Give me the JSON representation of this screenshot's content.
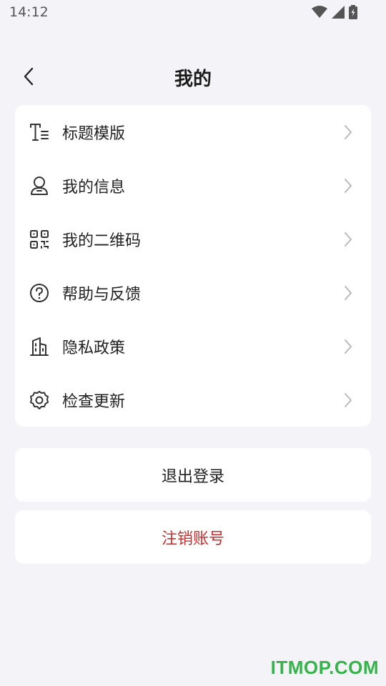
{
  "status_bar": {
    "time": "14:12"
  },
  "header": {
    "title": "我的"
  },
  "menu": {
    "items": [
      {
        "label": "标题模版",
        "icon": "title-template-icon"
      },
      {
        "label": "我的信息",
        "icon": "user-icon"
      },
      {
        "label": "我的二维码",
        "icon": "qr-code-icon"
      },
      {
        "label": "帮助与反馈",
        "icon": "help-icon"
      },
      {
        "label": "隐私政策",
        "icon": "building-icon"
      },
      {
        "label": "检查更新",
        "icon": "gear-icon"
      }
    ]
  },
  "actions": {
    "logout": "退出登录",
    "cancel_account": "注销账号"
  },
  "colors": {
    "background": "#f4f4f8",
    "card": "#ffffff",
    "danger": "#d42a2a",
    "watermark": "#34b449"
  },
  "watermark": "ITMOP.COM"
}
